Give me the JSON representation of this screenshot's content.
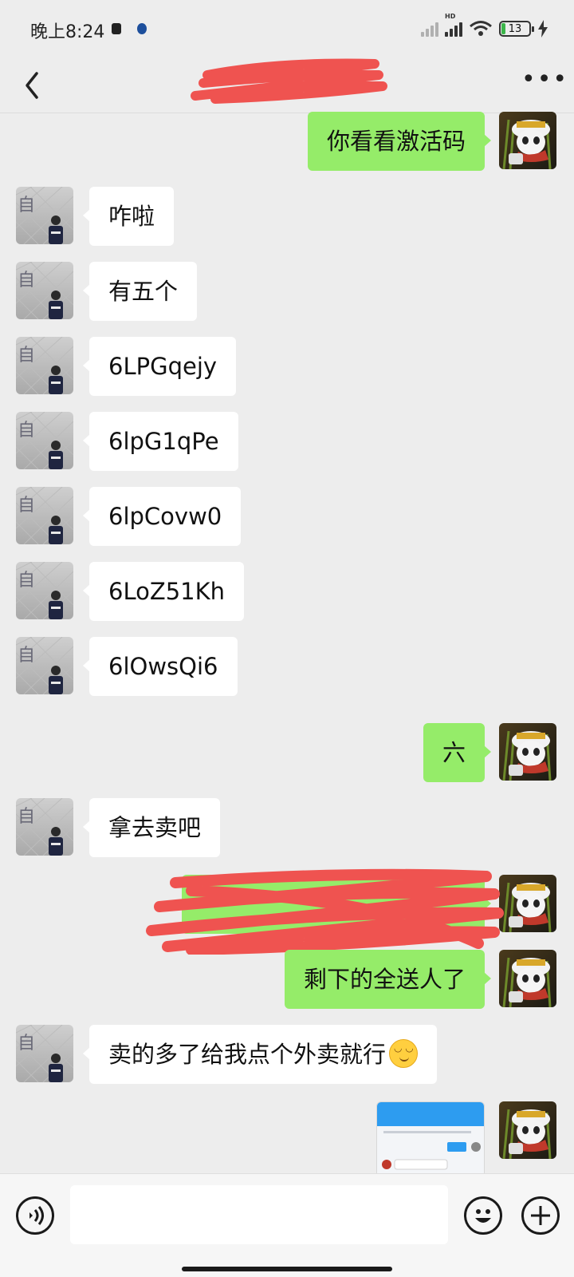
{
  "status_bar": {
    "time": "晚上8:24",
    "network": "HD",
    "battery": "13"
  },
  "header": {
    "back_icon": "chevron-left-icon",
    "more_icon": "more-dots-icon"
  },
  "messages": [
    {
      "side": "out",
      "text": "你看看激活码"
    },
    {
      "side": "in",
      "text": "咋啦"
    },
    {
      "side": "in",
      "text": "有五个"
    },
    {
      "side": "in",
      "text": "6LPGqejy"
    },
    {
      "side": "in",
      "text": "6lpG1qPe"
    },
    {
      "side": "in",
      "text": "6lpCovw0"
    },
    {
      "side": "in",
      "text": "6LoZ51Kh"
    },
    {
      "side": "in",
      "text": "6lOwsQi6"
    },
    {
      "side": "out",
      "text": "六"
    },
    {
      "side": "in",
      "text": "拿去卖吧"
    },
    {
      "side": "out",
      "text": ""
    },
    {
      "side": "out",
      "text": "剩下的全送人了"
    },
    {
      "side": "in",
      "text": "卖的多了给我点个外卖就行"
    },
    {
      "side": "out",
      "type": "image"
    }
  ],
  "input_bar": {
    "placeholder": "",
    "voice_icon": "voice-icon",
    "emoji_icon": "emoji-icon",
    "plus_icon": "plus-icon"
  },
  "colors": {
    "background": "#ededed",
    "outgoing_bubble": "#95ec69",
    "incoming_bubble": "#ffffff",
    "redaction": "#ef5350"
  }
}
